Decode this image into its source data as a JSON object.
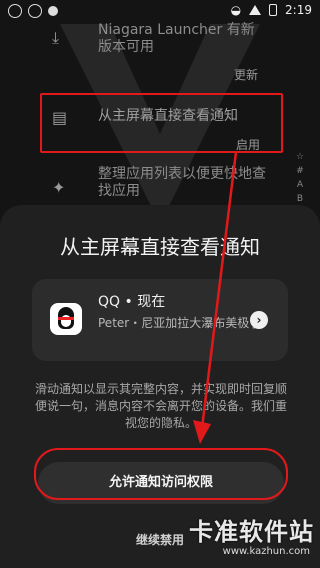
{
  "status_bar": {
    "time": "2:19"
  },
  "list": {
    "row1": {
      "text": "Niagara Launcher 有新版本可用",
      "action": "更新"
    },
    "row2": {
      "text": "从主屏幕直接查看通知",
      "action": "启用"
    },
    "row3": {
      "text": "整理应用列表以便更快地查找应用"
    },
    "alphabet": [
      "☆",
      "#",
      "A",
      "B"
    ]
  },
  "sheet": {
    "title": "从主屏幕直接查看通知",
    "notification": {
      "app": "QQ • 现在",
      "body": "Peter・尼亚加拉大瀑布美极了!"
    },
    "description": "滑动通知以显示其完整内容，并实现即时回复顺便说一句，消息内容不会离开您的设备。我们重视您的隐私。",
    "allow_button": "允许通知访问权限",
    "continue_link": "继续禁用"
  },
  "watermark": {
    "name": "卡准软件站",
    "url": "www.kazhun.com"
  },
  "colors": {
    "background": "#141414",
    "sheet": "#202020",
    "highlight": "#e2191b"
  }
}
